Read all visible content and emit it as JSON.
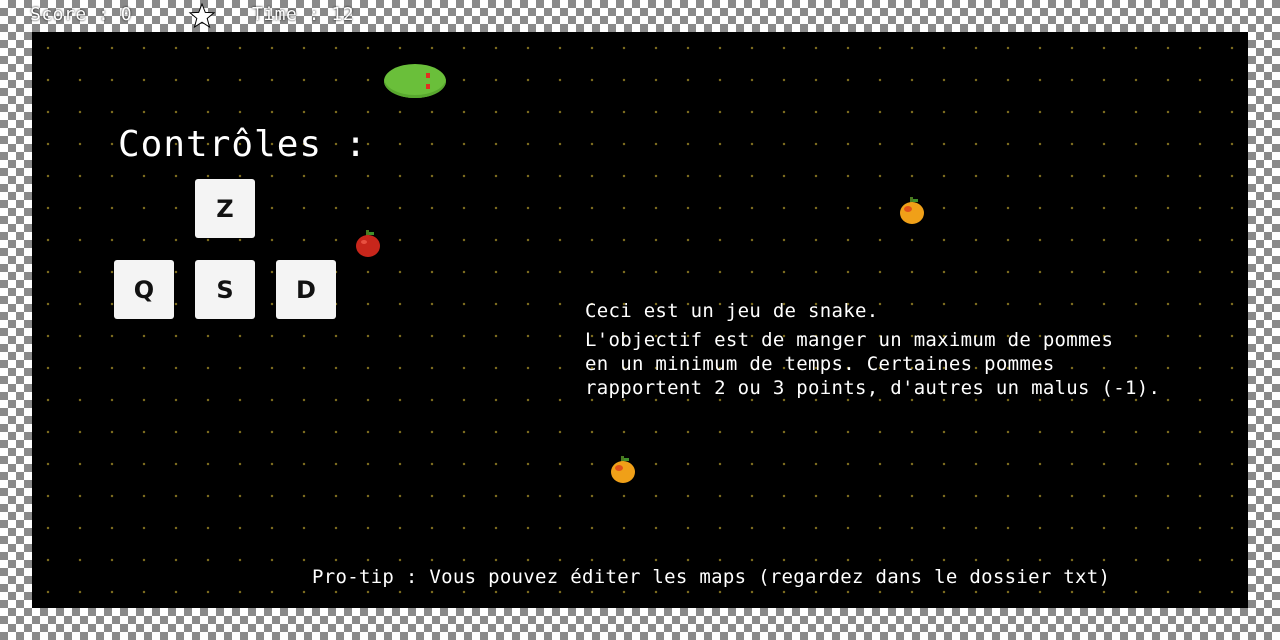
{
  "hud": {
    "score_label": "Score : 0",
    "star_icon": "star-icon",
    "time_label": "Time : 12"
  },
  "controls": {
    "title": "Contrôles :",
    "keys": {
      "up": "Z",
      "left": "Q",
      "down": "S",
      "right": "D"
    }
  },
  "info": {
    "line1": "Ceci est un jeu de snake.",
    "line2": "L'objectif est de manger un maximum de pommes",
    "line3": "en un minimum de temps. Certaines pommes",
    "line4": "rapportent 2 ou 3 points, d'autres un malus (-1)."
  },
  "protip": "Pro-tip : Vous pouvez éditer les maps (regardez dans le dossier txt)",
  "colors": {
    "board": "#000000",
    "grid_dot": "#7a6a1e",
    "snake": "#6abf3a",
    "snake_eye": "#e03020",
    "apple_red": "#c8261b",
    "apple_orange": "#f0a018"
  },
  "entities": {
    "snake": "snake-head",
    "apples": [
      "red-apple-icon",
      "orange-apple-icon",
      "orange-apple-icon"
    ]
  }
}
